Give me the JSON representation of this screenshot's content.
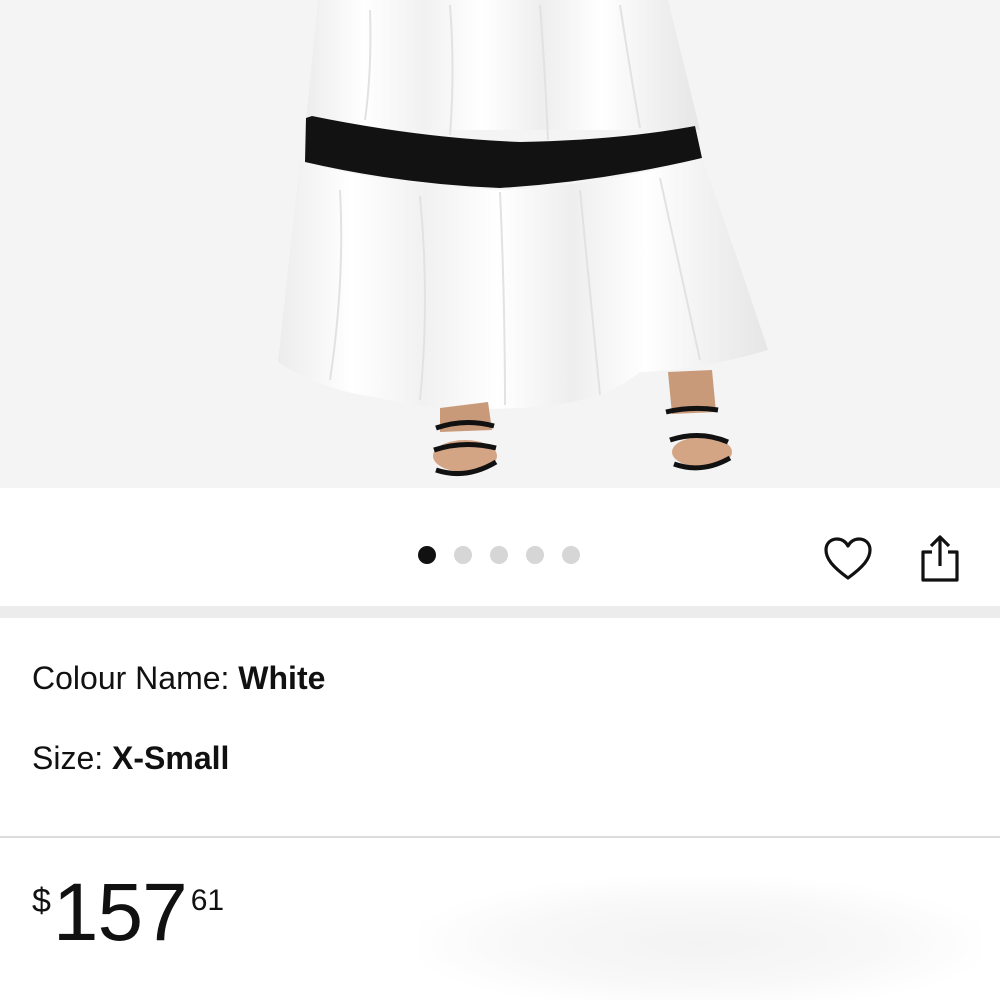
{
  "carousel": {
    "total_images": 5,
    "active_index": 0
  },
  "actions": {
    "wishlist_icon": "heart-outline-icon",
    "share_icon": "share-icon"
  },
  "variations": {
    "colour_label": "Colour Name: ",
    "colour_value": "White",
    "size_label": "Size: ",
    "size_value": "X-Small"
  },
  "price": {
    "currency_symbol": "$",
    "whole": "157",
    "fraction": "61"
  },
  "colors": {
    "active_dot": "#111111",
    "inactive_dot": "#d6d6d6",
    "background": "#ffffff",
    "image_background": "#f4f4f4"
  }
}
